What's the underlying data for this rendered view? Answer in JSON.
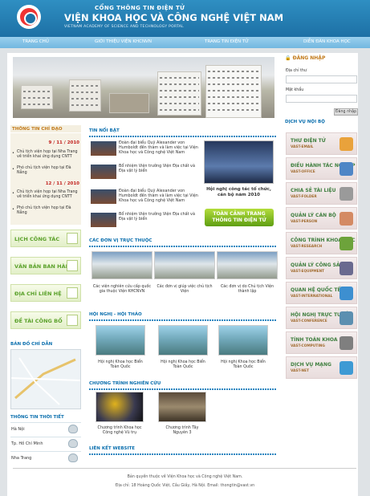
{
  "header": {
    "portal_line": "CỔNG THÔNG TIN ĐIỆN TỬ",
    "title": "VIỆN KHOA HỌC VÀ CÔNG NGHỆ VIỆT NAM",
    "subtitle": "VIETNAM ACADEMY OF SCIENCE AND TECHNOLOGY PORTAL"
  },
  "nav": [
    "TRANG CHỦ",
    "GIỚI THIỆU VIỆN KHCNVN",
    "TRANG TIN ĐIỆN TỬ",
    "DIỄN ĐÀN KHOA HỌC"
  ],
  "left": {
    "events_title": "THÔNG TIN CHỈ ĐẠO",
    "events": [
      {
        "date": "9 / 11 / 2010",
        "items": [
          "Chủ tịch viện họp tại Nha Trang về triển khai ứng dụng CNTT",
          "Phó chủ tịch viện họp tại Đà Nẵng"
        ]
      },
      {
        "date": "12 / 11 / 2010",
        "items": [
          "Chủ tịch viện họp tại Nha Trang về triển khai ứng dụng CNTT",
          "Phó chủ tịch viện họp tại Đà Nẵng"
        ]
      }
    ],
    "buttons": [
      "LỊCH CÔNG TÁC",
      "VĂN BẢN BAN HÀNH",
      "ĐỊA CHỈ LIÊN HỆ",
      "ĐỀ TÀI CÔNG BỐ"
    ],
    "map_title": "BẢN ĐỒ CHỈ DẪN",
    "weather_title": "THÔNG TIN THỜI TIẾT",
    "weather": [
      "Hà Nội",
      "Tp. Hồ Chí Minh",
      "Nha Trang"
    ]
  },
  "main": {
    "news_title": "TIN NỔI BẬT",
    "news": [
      "Đoàn đại biểu Quỹ Alexander von Humboldt đến thăm và làm việc tại Viện Khoa học và Công nghệ Việt Nam",
      "Bổ nhiệm Viện trưởng Viện Địa chất và Địa vật lý biển",
      "Đoàn đại biểu Quỹ Alexander von Humboldt đến thăm và làm việc tại Viện Khoa học và Công nghệ Việt Nam",
      "Bổ nhiệm Viện trưởng Viện Địa chất và Địa vật lý biển"
    ],
    "hot_caption": "Hội nghị công tác tổ chức, cán bộ năm 2010",
    "hot_button": "TOÀN CẢNH TRANG THÔNG TIN ĐIỆN TỬ",
    "units_title": "CÁC ĐƠN VỊ TRỰC THUỘC",
    "units": [
      "Các viện nghiên cứu cấp quốc gia thuộc Viện KHCNVN",
      "Các đơn vị giúp việc chủ tịch Viện",
      "Các đơn vị do Chủ tịch Viện thành lập"
    ],
    "conf_title": "HỘI NGHỊ - HỘI THẢO",
    "conf": [
      "Hội nghị Khoa học Biển Toàn Quốc",
      "Hội nghị Khoa học Biển Toàn Quốc",
      "Hội nghị Khoa học Biển Toàn Quốc"
    ],
    "prog_title": "CHƯƠNG TRÌNH NGHIÊN CỨU",
    "prog": [
      "Chương trình Khoa học Công nghệ Vũ trụ",
      "Chương trình Tây Nguyên 3"
    ],
    "links_title": "LIÊN KẾT WEBSITE"
  },
  "right": {
    "login_title": "ĐĂNG NHẬP",
    "email_label": "Địa chỉ thư",
    "password_label": "Mật khẩu",
    "login_button": "Đăng nhập",
    "services_title": "DỊCH VỤ NỘI BỘ",
    "services": [
      {
        "name": "THƯ ĐIỆN TỬ",
        "sub": "VAST-EMAIL",
        "color": "#e9a23b"
      },
      {
        "name": "ĐIỀU HÀNH TÁC NGHIỆP",
        "sub": "VAST-OFFICE",
        "color": "#4f86c6"
      },
      {
        "name": "CHIA SẺ TÀI LIỆU",
        "sub": "VAST-FOLDER",
        "color": "#9a9a9a"
      },
      {
        "name": "QUẢN LÝ CÁN BỘ",
        "sub": "VAST-PERSON",
        "color": "#d48a63"
      },
      {
        "name": "CÔNG TRÌNH KHOA HỌC",
        "sub": "VAST-RESEARCH",
        "color": "#6da33b"
      },
      {
        "name": "QUẢN LÝ CÔNG SẢN",
        "sub": "VAST-EQUIPMENT",
        "color": "#6a6a8f"
      },
      {
        "name": "QUAN HỆ QUỐC TẾ",
        "sub": "VAST-INTERNATIONAL",
        "color": "#3d8fd0"
      },
      {
        "name": "HỘI NGHỊ TRỰC TUYẾN",
        "sub": "VAST-CONFERENCE",
        "color": "#5b8fb0"
      },
      {
        "name": "TÍNH TOÁN KHOA HỌC",
        "sub": "VAST-COMPUTING",
        "color": "#7f7f7f"
      },
      {
        "name": "DỊCH VỤ MẠNG",
        "sub": "VAST-NET",
        "color": "#3e9ad4"
      }
    ]
  },
  "footer": {
    "line1": "Bản quyền thuộc về Viện Khoa học và Công nghệ Việt Nam.",
    "line2": "Địa chỉ: 18 Hoàng Quốc Việt, Cầu Giấy, Hà Nội. Email: thongtin@vast.vn"
  }
}
